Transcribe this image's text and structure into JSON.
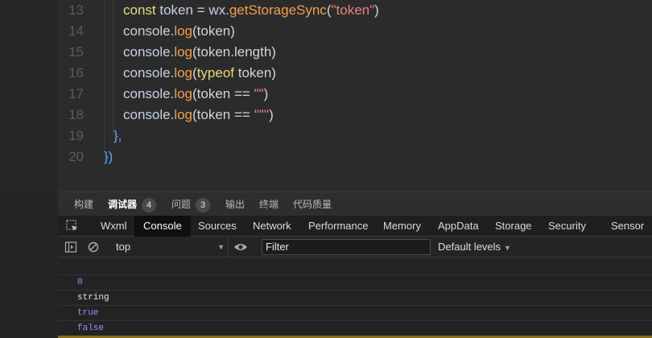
{
  "editor": {
    "lines": [
      {
        "num": "13",
        "tokens": [
          [
            "kw",
            "const"
          ],
          [
            "var",
            " token "
          ],
          [
            "pun",
            "= "
          ],
          [
            "var",
            "wx."
          ],
          [
            "fn",
            "getStorageSync"
          ],
          [
            "pun",
            "("
          ],
          [
            "str",
            "\"token\""
          ],
          [
            "pun",
            ")"
          ]
        ]
      },
      {
        "num": "14",
        "tokens": [
          [
            "var",
            "console."
          ],
          [
            "fn",
            "log"
          ],
          [
            "pun",
            "(token)"
          ]
        ]
      },
      {
        "num": "15",
        "tokens": [
          [
            "var",
            "console."
          ],
          [
            "fn",
            "log"
          ],
          [
            "pun",
            "(token.length)"
          ]
        ]
      },
      {
        "num": "16",
        "tokens": [
          [
            "var",
            "console."
          ],
          [
            "fn",
            "log"
          ],
          [
            "pun",
            "("
          ],
          [
            "kw",
            "typeof"
          ],
          [
            "pun",
            " token)"
          ]
        ]
      },
      {
        "num": "17",
        "tokens": [
          [
            "var",
            "console."
          ],
          [
            "fn",
            "log"
          ],
          [
            "pun",
            "(token == "
          ],
          [
            "str",
            "\"\""
          ],
          [
            "pun",
            ")"
          ]
        ]
      },
      {
        "num": "18",
        "tokens": [
          [
            "var",
            "console."
          ],
          [
            "fn",
            "log"
          ],
          [
            "pun",
            "(token == "
          ],
          [
            "str",
            "'\"\"'"
          ],
          [
            "pun",
            ")"
          ]
        ]
      },
      {
        "num": "19",
        "tokens": [
          [
            "brace",
            "},"
          ]
        ]
      },
      {
        "num": "20",
        "tokens": [
          [
            "brace",
            "})"
          ]
        ]
      }
    ]
  },
  "panel_tabs": [
    {
      "label": "构建",
      "badge": ""
    },
    {
      "label": "调试器",
      "badge": "4",
      "active": true
    },
    {
      "label": "问题",
      "badge": "3"
    },
    {
      "label": "输出",
      "badge": ""
    },
    {
      "label": "终端",
      "badge": ""
    },
    {
      "label": "代码质量",
      "badge": ""
    }
  ],
  "devtools_tabs": [
    "Wxml",
    "Console",
    "Sources",
    "Network",
    "Performance",
    "Memory",
    "AppData",
    "Storage",
    "Security",
    "Sensor"
  ],
  "devtools_active": "Console",
  "console_toolbar": {
    "context": "top",
    "filter_placeholder": "Filter",
    "levels": "Default levels"
  },
  "console_output": [
    {
      "text": "0",
      "kind": "number"
    },
    {
      "text": "string",
      "kind": "string"
    },
    {
      "text": "true",
      "kind": "boolean"
    },
    {
      "text": "false",
      "kind": "boolean"
    }
  ],
  "colors": {
    "keyword": "#e7db74",
    "function": "#f0a04b",
    "string": "#ec8078",
    "brace": "#5aa4ff",
    "console_value": "#9d8cf5"
  }
}
